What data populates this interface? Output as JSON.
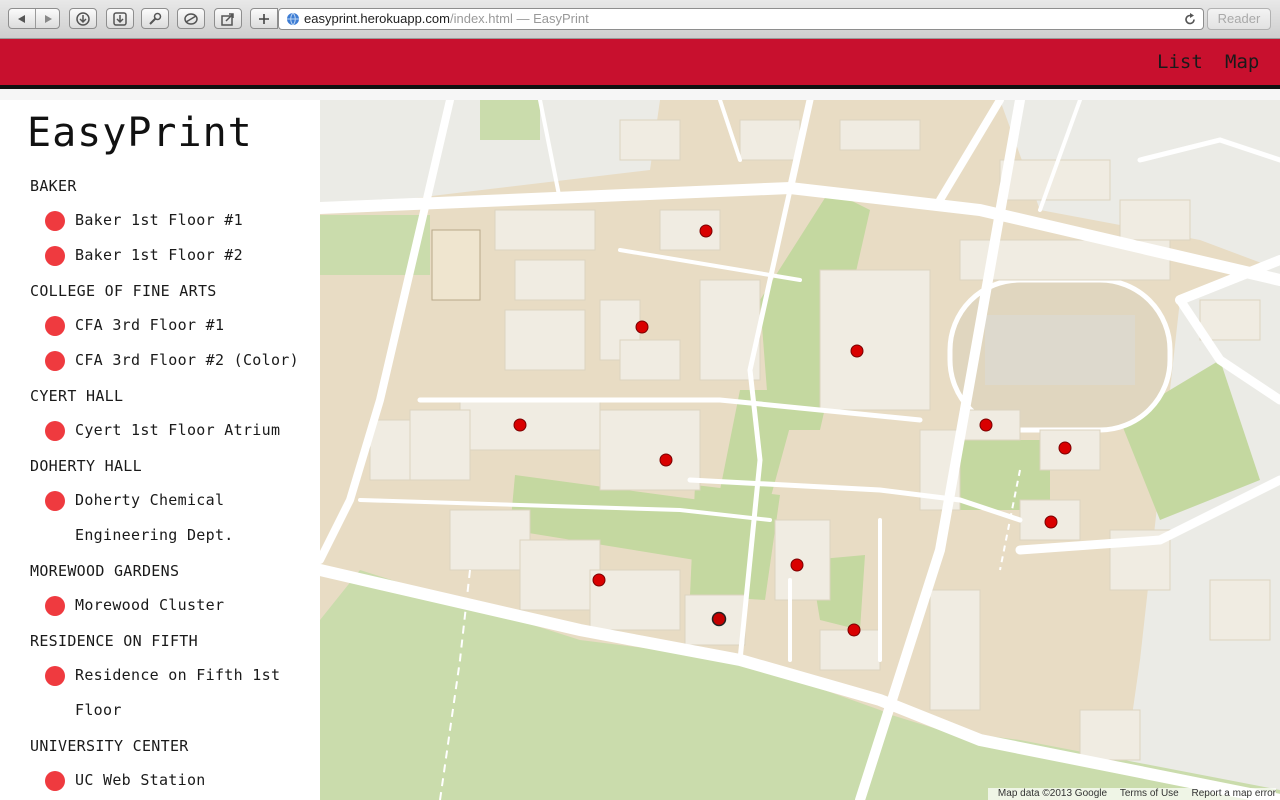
{
  "browser": {
    "url_host": "easyprint.herokuapp.com",
    "url_path": "/index.html",
    "url_separator": " — ",
    "page_title": "EasyPrint",
    "reader_label": "Reader"
  },
  "header": {
    "bg_color": "#c8102e",
    "nav": [
      "List",
      "Map"
    ]
  },
  "sidebar": {
    "title": "EasyPrint",
    "groups": [
      {
        "name": "BAKER",
        "printers": [
          "Baker 1st Floor #1",
          "Baker 1st Floor #2"
        ]
      },
      {
        "name": "COLLEGE OF FINE ARTS",
        "printers": [
          "CFA 3rd Floor #1",
          "CFA 3rd Floor #2 (Color)"
        ]
      },
      {
        "name": "CYERT HALL",
        "printers": [
          "Cyert 1st Floor Atrium"
        ]
      },
      {
        "name": "DOHERTY HALL",
        "printers": [
          "Doherty Chemical Engineering Dept."
        ]
      },
      {
        "name": "MOREWOOD GARDENS",
        "printers": [
          "Morewood Cluster"
        ]
      },
      {
        "name": "RESIDENCE ON FIFTH",
        "printers": [
          "Residence on Fifth 1st Floor"
        ]
      },
      {
        "name": "UNIVERSITY CENTER",
        "printers": [
          "UC Web Station"
        ]
      }
    ],
    "dot_color": "#ef3a3f"
  },
  "map": {
    "marker_color": "#d90000",
    "marker_count": 12,
    "attribution": "Map data ©2013 Google",
    "terms": "Terms of Use",
    "report": "Report a map error"
  }
}
